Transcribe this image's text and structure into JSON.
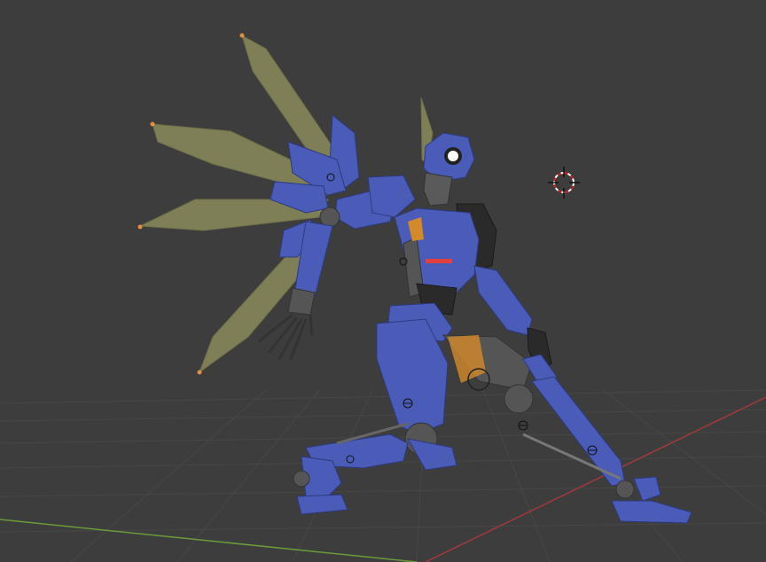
{
  "app": {
    "name": "3D viewport",
    "view": "perspective"
  },
  "viewport": {
    "background_color": "#3d3d3d",
    "grid_color": "#474747",
    "x_axis_color": "#a33a3a",
    "y_axis_color": "#6b9a3a"
  },
  "scene": {
    "cursor_icon": "3d-cursor-icon",
    "model": {
      "type": "robot-character",
      "primary_color": "#4a5cb8",
      "joint_color": "#555555",
      "accent_color": "#d48a2a",
      "wing_color": "#8a8a5c",
      "eye_color": "#ffffff"
    }
  }
}
